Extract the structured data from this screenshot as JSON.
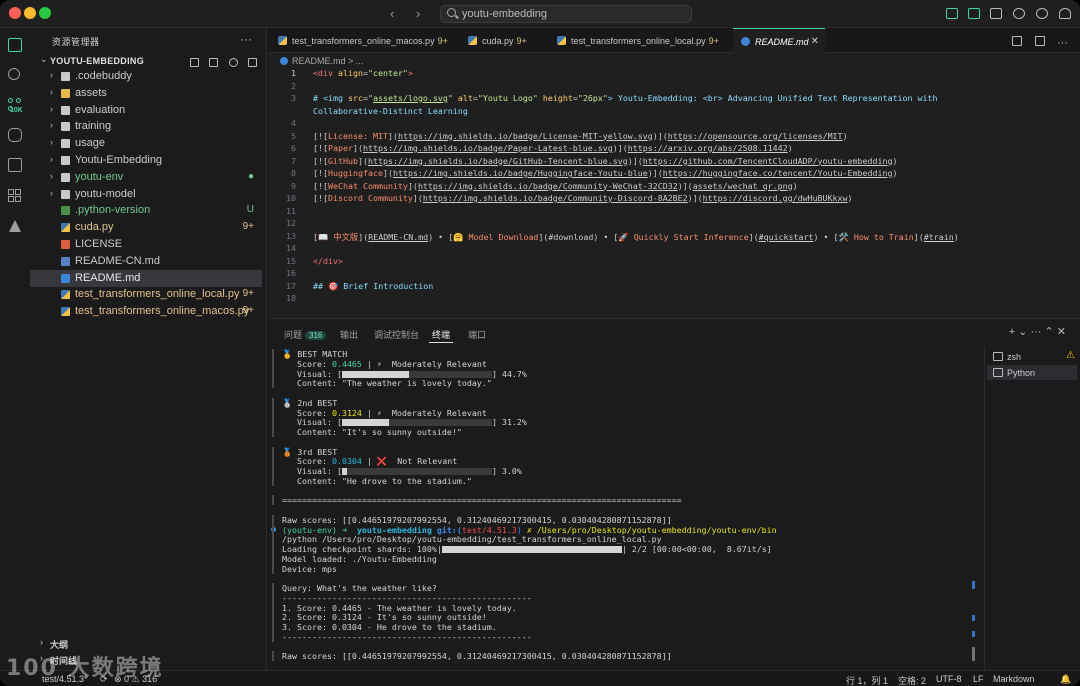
{
  "search": {
    "text": "youtu-embedding"
  },
  "sidebar": {
    "title": "资源管理器",
    "more": "···",
    "project": "YOUTU-EMBEDDING",
    "items": [
      {
        "label": ".codebuddy",
        "kind": "folder",
        "status": "",
        "color": "#cccccc"
      },
      {
        "label": "assets",
        "kind": "folder-assets",
        "status": "",
        "color": "#cccccc"
      },
      {
        "label": "evaluation",
        "kind": "folder",
        "status": "",
        "color": "#cccccc"
      },
      {
        "label": "training",
        "kind": "folder",
        "status": "",
        "color": "#cccccc"
      },
      {
        "label": "usage",
        "kind": "folder",
        "status": "",
        "color": "#cccccc"
      },
      {
        "label": "Youtu-Embedding",
        "kind": "folder",
        "status": "",
        "color": "#cccccc"
      },
      {
        "label": "youtu-env",
        "kind": "folder",
        "status": "●",
        "color": "#73c991"
      },
      {
        "label": "youtu-model",
        "kind": "folder",
        "status": "",
        "color": "#cccccc"
      },
      {
        "label": ".python-version",
        "kind": "pyv",
        "status": "U",
        "color": "#73c991"
      },
      {
        "label": "cuda.py",
        "kind": "py",
        "status": "9+",
        "color": "#e2c08d"
      },
      {
        "label": "LICENSE",
        "kind": "lic",
        "status": "",
        "color": "#cccccc"
      },
      {
        "label": "README-CN.md",
        "kind": "mdc",
        "status": "",
        "color": "#cccccc"
      },
      {
        "label": "README.md",
        "kind": "md",
        "status": "",
        "color": "#e8e8e8"
      },
      {
        "label": "test_transformers_online_local.py",
        "kind": "py",
        "status": "9+",
        "color": "#e2c08d"
      },
      {
        "label": "test_transformers_online_macos.py",
        "kind": "py",
        "status": "9+",
        "color": "#e2c08d"
      }
    ],
    "outline": "大纲",
    "timeline": "时间线"
  },
  "tabs": [
    {
      "label": "test_transformers_online_macos.py",
      "mod": "9+"
    },
    {
      "label": "cuda.py",
      "mod": "9+"
    },
    {
      "label": "test_transformers_online_local.py",
      "mod": "9+"
    },
    {
      "label": "README.md",
      "mod": ""
    }
  ],
  "breadcrumb": "README.md > ...",
  "code_lines": [
    {
      "n": "1",
      "html": "<span class='c-tag'>&lt;div</span> <span class='c-attr'>align</span>=<span class='c-str'>\"center\"</span><span class='c-tag'>&gt;</span>"
    },
    {
      "n": "2",
      "html": ""
    },
    {
      "n": "3",
      "html": "<span class='c-md'># &lt;img</span> <span class='c-attr'>src</span>=<span class='c-str'>\"<u>assets/logo.svg</u>\"</span> <span class='c-attr'>alt</span>=<span class='c-str'>\"Youtu Logo\"</span> <span class='c-attr'>height</span>=<span class='c-str'>\"26px\"</span><span class='c-md'>&gt; Youtu-Embedding: &lt;br&gt; Advancing Unified Text Representation with</span>"
    },
    {
      "n": "",
      "html": "<span class='c-md'>Collaborative-Distinct Learning</span>"
    },
    {
      "n": "4",
      "html": ""
    },
    {
      "n": "5",
      "html": "[![<span class='c-link'>License: MIT</span>](<span class='c-url'>https://img.shields.io/badge/License-MIT-yellow.svg</span>)](<span class='c-url'>https://opensource.org/licenses/MIT</span>)"
    },
    {
      "n": "6",
      "html": "[![<span class='c-link'>Paper</span>](<span class='c-url'>https://img.shields.io/badge/Paper-Latest-blue.svg</span>)](<span class='c-url'>https://arxiv.org/abs/2508.11442</span>)"
    },
    {
      "n": "7",
      "html": "[![<span class='c-link'>GitHub</span>](<span class='c-url'>https://img.shields.io/badge/GitHub-Tencent-blue.svg</span>)](<span class='c-url'>https://github.com/TencentCloudADP/youtu-embedding</span>)"
    },
    {
      "n": "8",
      "html": "[![<span class='c-link'>Huggingface</span>](<span class='c-url'>https://img.shields.io/badge/Huggingface-Youtu-blue</span>)](<span class='c-url'>https://huggingface.co/tencent/Youtu-Embedding</span>)"
    },
    {
      "n": "9",
      "html": "[![<span class='c-link'>WeChat Community</span>](<span class='c-url'>https://img.shields.io/badge/Community-WeChat-32CD32</span>)](<span class='c-url'>assets/wechat_qr.png</span>)"
    },
    {
      "n": "10",
      "html": "[![<span class='c-link'>Discord Community</span>](<span class='c-url'>https://img.shields.io/badge/Community-Discord-8A2BE2</span>)](<span class='c-url'>https://discord.gg/dwHuBUKkxw</span>)"
    },
    {
      "n": "11",
      "html": ""
    },
    {
      "n": "12",
      "html": ""
    },
    {
      "n": "13",
      "html": "[📖 <span class='c-link'>中文版</span>](<span class='c-url'>README-CN.md</span>) • [🤗 <span class='c-link'>Model Download</span>](#download) • [🚀 <span class='c-link'>Quickly Start Inference</span>](<span class='c-url'>#quickstart</span>) • [🛠️ <span class='c-link'>How to Train</span>](<span class='c-url'>#train</span>)"
    },
    {
      "n": "14",
      "html": ""
    },
    {
      "n": "15",
      "html": "<span class='c-tag'>&lt;/div&gt;</span>"
    },
    {
      "n": "16",
      "html": ""
    },
    {
      "n": "17",
      "html": "<span class='c-md'>## 🎯 Brief Introduction</span>"
    },
    {
      "n": "18",
      "html": ""
    }
  ],
  "panel": {
    "tabs": [
      {
        "label": "问题",
        "badge": "316"
      },
      {
        "label": "输出",
        "badge": ""
      },
      {
        "label": "调试控制台",
        "badge": ""
      },
      {
        "label": "终端",
        "badge": ""
      },
      {
        "label": "端口",
        "badge": ""
      }
    ],
    "actions": "+ ⌄  ···  ⌃  ✕",
    "terminals": [
      {
        "label": "zsh",
        "warn": "⚠"
      },
      {
        "label": "Python",
        "warn": ""
      }
    ]
  },
  "results": [
    {
      "medal": "🥇",
      "rank": "BEST MATCH",
      "score": "0.4465",
      "score_color": "#3dd6a8",
      "rel_icon": "⚡",
      "relevance": "Moderately Relevant",
      "visual_pct": 0.447,
      "visual_label": "44.7%",
      "content": "\"The weather is lovely today.\""
    },
    {
      "medal": "🥈",
      "rank": "2nd BEST",
      "score": "0.3124",
      "score_color": "#e5e510",
      "rel_icon": "⚡",
      "relevance": "Moderately Relevant",
      "visual_pct": 0.312,
      "visual_label": "31.2%",
      "content": "\"It's so sunny outside!\""
    },
    {
      "medal": "🥉",
      "rank": "3rd BEST",
      "score": "0.0304",
      "score_color": "#29b8db",
      "rel_icon": "❌",
      "relevance": "Not Relevant",
      "visual_pct": 0.03,
      "visual_label": "3.0%",
      "content": "\"He drove to the stadium.\""
    }
  ],
  "terminal": {
    "raw1": "Raw scores: [[0.44651979207992554, 0.31240469217300415, 0.030404280871152878]]",
    "prompt_env": "(youtu-env)",
    "prompt_dir": "youtu-embedding",
    "prompt_git": "git:(",
    "prompt_branch": "test/4.51.3",
    "prompt_rest": "✗ /Users/pro/Desktop/youtu-embedding/youtu-env/bin",
    "cmd2": "/python /Users/pro/Desktop/youtu-embedding/test_transformers_online_local.py",
    "loading_prefix": "Loading checkpoint shards: 100%|",
    "loading_suffix": "| 2/2 [00:00<00:00,  8.67it/s]",
    "loading_pct": 1.0,
    "model_loaded": "Model loaded: ./Youtu-Embedding",
    "device": "Device: mps",
    "query": "Query: What's the weather like?",
    "dash": "--------------------------------------------------",
    "r1": "1. Score: 0.4465 - The weather is lovely today.",
    "r2": "2. Score: 0.3124 - It's so sunny outside!",
    "r3": "3. Score: 0.0304 - He drove to the stadium.",
    "raw2": "Raw scores: [[0.44651979207992554, 0.31240469217300415, 0.030404280871152878]]",
    "eq": "================================================================================"
  },
  "status": {
    "branch": "test/4.51.3*",
    "sync": "⟳",
    "problems": "⊗ 0 ⚠ 316",
    "position": "行 1，列 1",
    "spaces": "空格: 2",
    "encoding": "UTF-8",
    "eol": "LF",
    "language": "Markdown",
    "bell": "🔔"
  },
  "watermark": "100 大数跨境"
}
